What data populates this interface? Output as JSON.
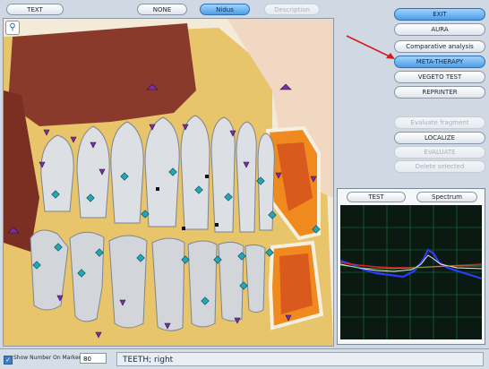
{
  "top_bar": {
    "text_label": "TEXT",
    "none_label": "NONE",
    "nidus_label": "Nidus",
    "description_label": "Description"
  },
  "right_panel": {
    "exit_label": "EXIT",
    "aura_label": "AURA",
    "comparative_label": "Comparative analysis",
    "meta_label": "META-THERAPY",
    "vegeto_label": "VEGETO TEST",
    "reprinter_label": "REPRINTER",
    "evaluate_fragment_label": "Evaluate fragment",
    "localize_label": "LOCALIZE",
    "evaluate_label": "EVALUATE",
    "delete_label": "Delete selected"
  },
  "graph": {
    "test_label": "TEST",
    "spectrum_label": "Spectrum"
  },
  "status_bar": {
    "checkbox_label": "Show Number On Marker",
    "checkbox_checked": true,
    "number_value": "80",
    "status_text": "TEETH; right"
  },
  "colors": {
    "accent": "#4e9ee6",
    "bone": "#e8c46a",
    "gum": "#8a3a2a",
    "marker_triangle": "#7b2fa8",
    "marker_diamond": "#1ea8b8",
    "graph_bg": "#0a1a12",
    "graph_grid": "#1f7a3a"
  }
}
